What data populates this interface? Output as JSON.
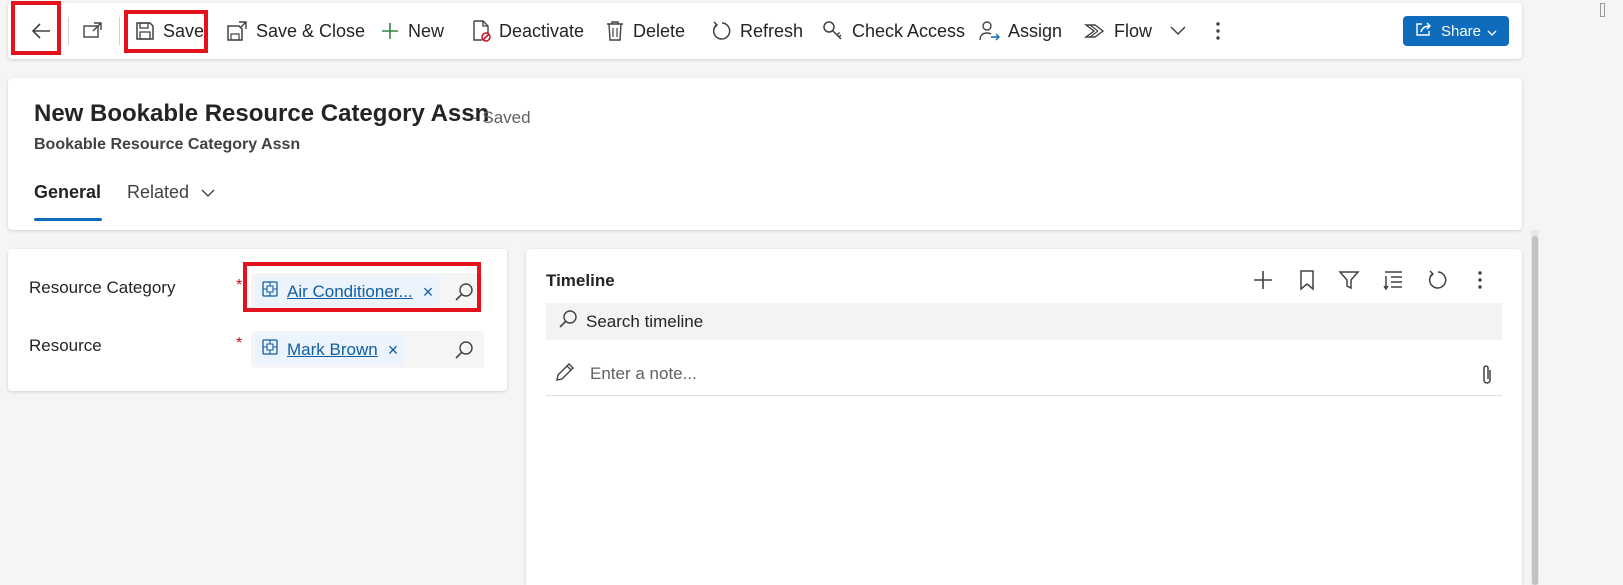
{
  "toolbar": {
    "back_icon": "arrow-left-icon",
    "popout_icon": "open-in-new-window-icon",
    "save_label": "Save",
    "save_close_label": "Save & Close",
    "new_label": "New",
    "deactivate_label": "Deactivate",
    "delete_label": "Delete",
    "refresh_label": "Refresh",
    "check_access_label": "Check Access",
    "assign_label": "Assign",
    "flow_label": "Flow",
    "share_label": "Share",
    "accent_color": "#0f6cbd",
    "highlight_color": "#e3121b"
  },
  "header": {
    "title": "New Bookable Resource Category Assn",
    "save_status": "- Saved",
    "entity_name": "Bookable Resource Category Assn",
    "tabs": [
      {
        "label": "General",
        "selected": true
      },
      {
        "label": "Related",
        "selected": false
      }
    ]
  },
  "form": {
    "fields": [
      {
        "label": "Resource Category",
        "required_marker": "*",
        "value": "Air Conditioner..."
      },
      {
        "label": "Resource",
        "required_marker": "*",
        "value": "Mark Brown"
      }
    ],
    "remove_glyph": "×"
  },
  "timeline": {
    "title": "Timeline",
    "search_placeholder": "Search timeline",
    "note_placeholder": "Enter a note..."
  }
}
